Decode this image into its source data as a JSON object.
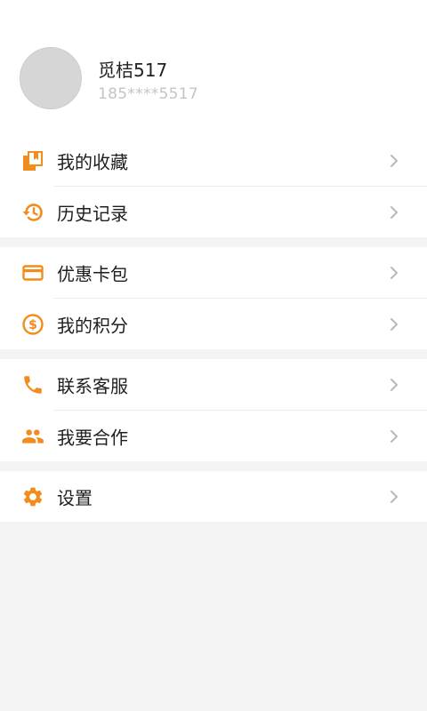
{
  "profile": {
    "username": "觅桔517",
    "phone": "185****5517"
  },
  "menu": {
    "favorites": "我的收藏",
    "history": "历史记录",
    "coupons": "优惠卡包",
    "points": "我的积分",
    "service": "联系客服",
    "cooperate": "我要合作",
    "settings": "设置"
  },
  "colors": {
    "accent": "#f28c1c",
    "chevron": "#b8b8b8",
    "background": "#f4f4f4"
  }
}
